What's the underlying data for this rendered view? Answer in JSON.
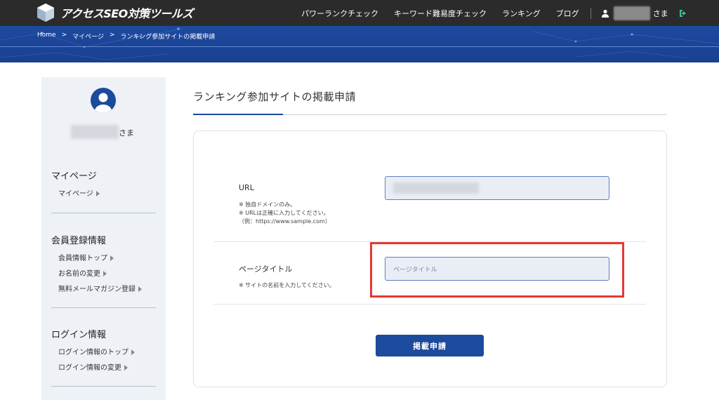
{
  "header": {
    "logo_text": "アクセスSEO対策ツールズ",
    "nav": [
      "パワーランクチェック",
      "キーワード難易度チェック",
      "ランキング",
      "ブログ"
    ],
    "user_suffix": "さま"
  },
  "breadcrumb": [
    "Home",
    ">",
    "マイページ",
    ">",
    "ランキング参加サイトの掲載申請"
  ],
  "sidebar": {
    "user_suffix": "さま",
    "sections": [
      {
        "title": "マイページ",
        "links": [
          "マイページ"
        ]
      },
      {
        "title": "会員登録情報",
        "links": [
          "会員情報トップ",
          "お名前の変更",
          "無料メールマガジン登録"
        ]
      },
      {
        "title": "ログイン情報",
        "links": [
          "ログイン情報のトップ",
          "ログイン情報の変更"
        ]
      }
    ]
  },
  "main": {
    "title": "ランキング参加サイトの掲載申請",
    "fields": {
      "url": {
        "label": "URL",
        "notes": [
          "※ 独自ドメインのみ。",
          "※ URLは正確に入力してください。",
          "（例：https://www.sample.com）"
        ]
      },
      "page_title": {
        "label": "ページタイトル",
        "placeholder": "ページタイトル",
        "notes": [
          "※ サイトの名前を入力してください。"
        ]
      }
    },
    "submit_label": "掲載申請"
  },
  "colors": {
    "topbar": "#2b2b2b",
    "banner": "#1d4aa0",
    "accent": "#1c4a9c",
    "highlight": "#e53935",
    "logout": "#3fbf9f"
  }
}
